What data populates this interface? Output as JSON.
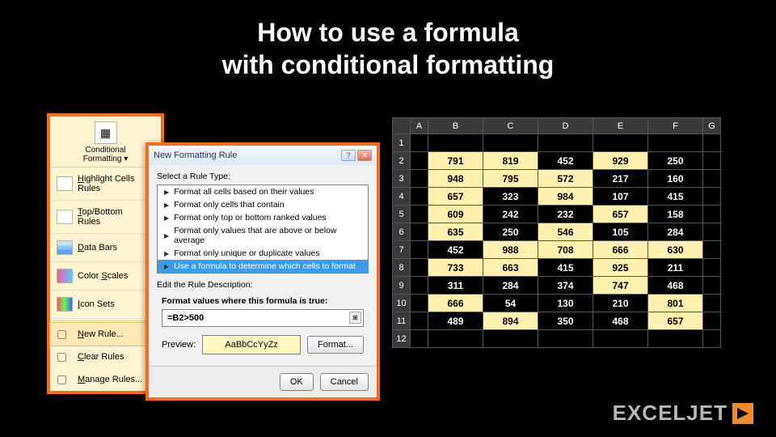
{
  "title_line1": "How to use a formula",
  "title_line2": "with conditional formatting",
  "logo_text": "EXCELJET",
  "ribbon": {
    "button_label": "Conditional\nFormatting ▾",
    "items": [
      {
        "label": "Highlight Cells Rules",
        "u": 0,
        "chev": true,
        "cls": ""
      },
      {
        "label": "Top/Bottom Rules",
        "u": 0,
        "chev": true,
        "cls": ""
      },
      {
        "label": "Data Bars",
        "u": 0,
        "chev": true,
        "cls": "db"
      },
      {
        "label": "Color Scales",
        "u": 6,
        "chev": true,
        "cls": "cs"
      },
      {
        "label": "Icon Sets",
        "u": 0,
        "chev": true,
        "cls": "is"
      }
    ],
    "simple": [
      {
        "label": "New Rule...",
        "u": 0,
        "sel": true
      },
      {
        "label": "Clear Rules",
        "u": 0,
        "chev": true
      },
      {
        "label": "Manage Rules...",
        "u": 0
      }
    ]
  },
  "dialog": {
    "title": "New Formatting Rule",
    "select_label": "Select a Rule Type:",
    "rules": [
      "Format all cells based on their values",
      "Format only cells that contain",
      "Format only top or bottom ranked values",
      "Format only values that are above or below average",
      "Format only unique or duplicate values",
      "Use a formula to determine which cells to format"
    ],
    "edit_label": "Edit the Rule Description:",
    "formula_label": "Format values where this formula is true:",
    "formula_value": "=B2>500",
    "preview_label": "Preview:",
    "preview_text": "AaBbCcYyZz",
    "format_btn": "Format...",
    "ok_btn": "OK",
    "cancel_btn": "Cancel"
  },
  "grid": {
    "cols": [
      "A",
      "B",
      "C",
      "D",
      "E",
      "F",
      "G"
    ],
    "rows": [
      {
        "n": 1,
        "cells": [
          "",
          "",
          "",
          "",
          "",
          "",
          ""
        ]
      },
      {
        "n": 2,
        "cells": [
          "",
          "791",
          "819",
          "452",
          "929",
          "250",
          ""
        ]
      },
      {
        "n": 3,
        "cells": [
          "",
          "948",
          "795",
          "572",
          "217",
          "160",
          ""
        ]
      },
      {
        "n": 4,
        "cells": [
          "",
          "657",
          "323",
          "984",
          "107",
          "415",
          ""
        ]
      },
      {
        "n": 5,
        "cells": [
          "",
          "609",
          "242",
          "232",
          "657",
          "158",
          ""
        ]
      },
      {
        "n": 6,
        "cells": [
          "",
          "635",
          "250",
          "546",
          "105",
          "284",
          ""
        ]
      },
      {
        "n": 7,
        "cells": [
          "",
          "452",
          "988",
          "708",
          "666",
          "630",
          ""
        ]
      },
      {
        "n": 8,
        "cells": [
          "",
          "733",
          "663",
          "415",
          "925",
          "211",
          ""
        ]
      },
      {
        "n": 9,
        "cells": [
          "",
          "311",
          "284",
          "374",
          "747",
          "468",
          ""
        ]
      },
      {
        "n": 10,
        "cells": [
          "",
          "666",
          "54",
          "130",
          "210",
          "801",
          ""
        ]
      },
      {
        "n": 11,
        "cells": [
          "",
          "489",
          "894",
          "350",
          "468",
          "657",
          ""
        ]
      },
      {
        "n": 12,
        "cells": [
          "",
          "",
          "",
          "",
          "",
          "",
          ""
        ]
      }
    ],
    "highlight_threshold": 500
  }
}
